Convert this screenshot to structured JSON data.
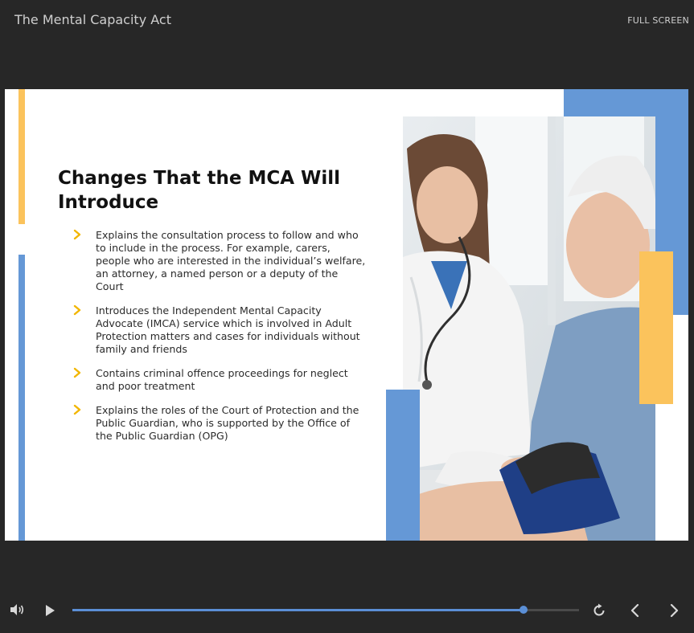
{
  "header": {
    "course_title": "The Mental Capacity Act",
    "fullscreen_label": "FULL SCREEN"
  },
  "slide": {
    "heading": "Changes That the MCA Will Introduce",
    "bullets": [
      "Explains the consultation process to follow and who to include in the process. For example, carers, people who are interested in the individual’s welfare, an attorney, a named person or a deputy of the Court",
      "Introduces the Independent Mental Capacity Advocate (IMCA) service which is involved in Adult Protection matters and cases for individuals without family and friends",
      "Contains criminal offence proceedings for neglect and poor treatment",
      "Explains the roles of the Court of Protection and the Public Guardian, who is supported by the Office of the Public Guardian (OPG)"
    ],
    "image_alt": "Doctor measuring blood pressure of an elderly man"
  },
  "player": {
    "progress_fraction": 0.89,
    "icons": [
      "volume-icon",
      "play-icon",
      "replay-icon",
      "previous-icon",
      "next-icon"
    ]
  },
  "colors": {
    "background": "#272727",
    "accent_blue": "#6598d6",
    "accent_yellow": "#fbc35c",
    "chevron_yellow": "#f2b600",
    "progress_blue": "#5b8fd6"
  }
}
